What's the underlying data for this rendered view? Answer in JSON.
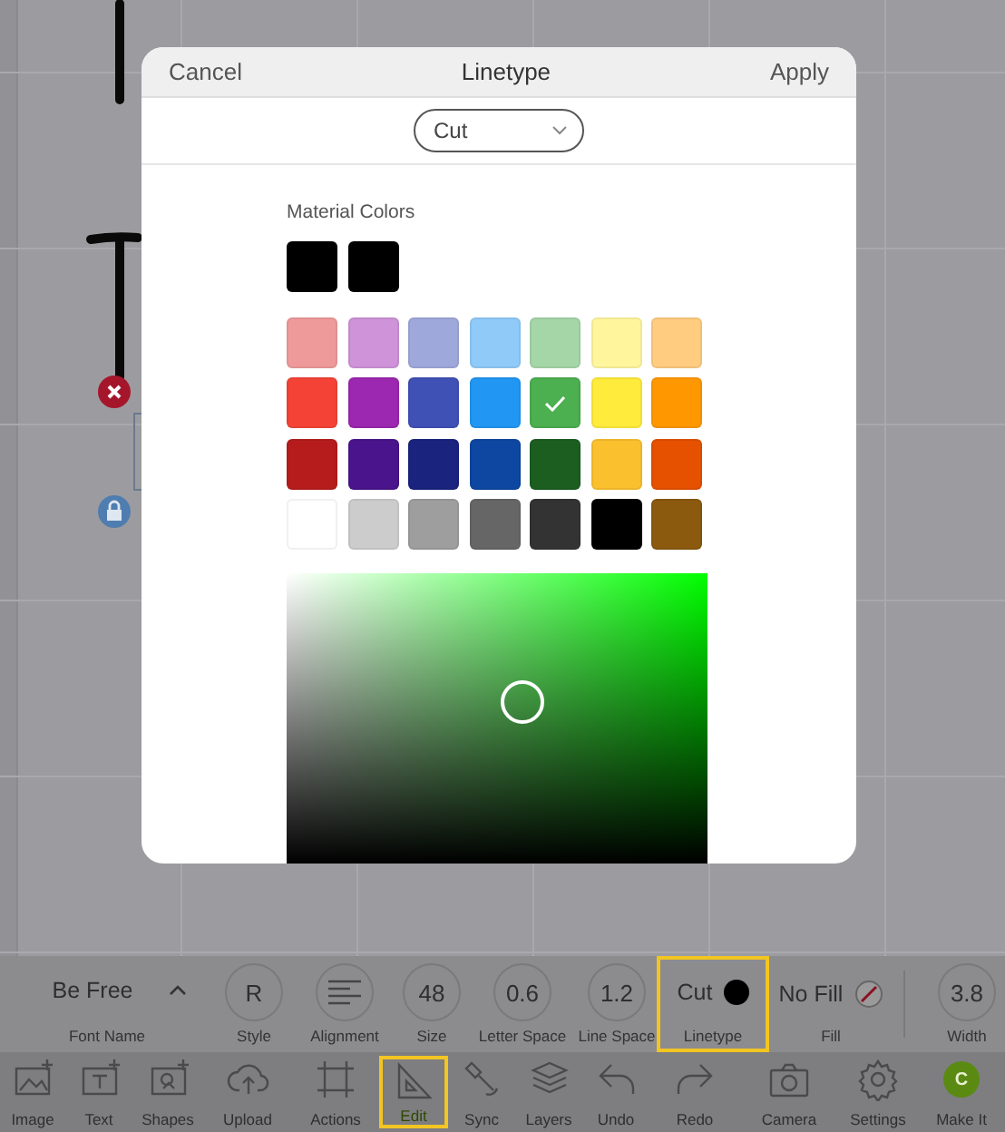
{
  "dialog": {
    "cancel": "Cancel",
    "title": "Linetype",
    "apply": "Apply",
    "linetype_dropdown": {
      "value": "Cut"
    },
    "section_label": "Material Colors",
    "basic_colors": [
      {
        "color": "#000000"
      },
      {
        "color": "#000000"
      }
    ],
    "palette": [
      {
        "color": "#ef9a9a",
        "selected": false
      },
      {
        "color": "#ce93d8",
        "selected": false
      },
      {
        "color": "#9fa8da",
        "selected": false
      },
      {
        "color": "#90caf9",
        "selected": false
      },
      {
        "color": "#a5d6a7",
        "selected": false
      },
      {
        "color": "#fff59d",
        "selected": false
      },
      {
        "color": "#ffcc80",
        "selected": false
      },
      {
        "color": "#f44336",
        "selected": false
      },
      {
        "color": "#9c27b0",
        "selected": false
      },
      {
        "color": "#3f51b5",
        "selected": false
      },
      {
        "color": "#2196f3",
        "selected": false
      },
      {
        "color": "#4caf50",
        "selected": true
      },
      {
        "color": "#ffeb3b",
        "selected": false
      },
      {
        "color": "#ff9800",
        "selected": false
      },
      {
        "color": "#b71c1c",
        "selected": false
      },
      {
        "color": "#4a148c",
        "selected": false
      },
      {
        "color": "#1a237e",
        "selected": false
      },
      {
        "color": "#0d47a1",
        "selected": false
      },
      {
        "color": "#1b5e20",
        "selected": false
      },
      {
        "color": "#fbc02d",
        "selected": false
      },
      {
        "color": "#e65100",
        "selected": false
      },
      {
        "color": "#ffffff",
        "selected": false
      },
      {
        "color": "#cccccc",
        "selected": false
      },
      {
        "color": "#9e9e9e",
        "selected": false
      },
      {
        "color": "#666666",
        "selected": false
      },
      {
        "color": "#333333",
        "selected": false
      },
      {
        "color": "#000000",
        "selected": false
      },
      {
        "color": "#8b5a0e",
        "selected": false
      }
    ]
  },
  "properties": [
    {
      "kind": "dropdown",
      "label": "Font Name",
      "value": "Be Free",
      "highlighted": false
    },
    {
      "kind": "circle",
      "label": "Style",
      "value": "R",
      "highlighted": false
    },
    {
      "kind": "align",
      "label": "Alignment",
      "highlighted": false
    },
    {
      "kind": "circle",
      "label": "Size",
      "value": "48",
      "highlighted": false
    },
    {
      "kind": "circle",
      "label": "Letter Space",
      "value": "0.6",
      "highlighted": false
    },
    {
      "kind": "circle",
      "label": "Line Space",
      "value": "1.2",
      "highlighted": false
    },
    {
      "kind": "swatch",
      "label": "Linetype",
      "value": "Cut",
      "color": "#000000",
      "highlighted": true
    },
    {
      "kind": "nofill",
      "label": "Fill",
      "value": "No Fill",
      "highlighted": false
    },
    {
      "kind": "circle",
      "label": "Width",
      "value": "3.8",
      "highlighted": false
    }
  ],
  "toolbar": [
    {
      "label": "Image",
      "highlighted": false
    },
    {
      "label": "Text",
      "highlighted": false
    },
    {
      "label": "Shapes",
      "highlighted": false
    },
    {
      "label": "Upload",
      "highlighted": false
    },
    {
      "label": "Actions",
      "highlighted": false
    },
    {
      "label": "Edit",
      "highlighted": true
    },
    {
      "label": "Sync",
      "highlighted": false
    },
    {
      "label": "Layers",
      "highlighted": false
    },
    {
      "label": "Undo",
      "highlighted": false
    },
    {
      "label": "Redo",
      "highlighted": false
    },
    {
      "label": "Camera",
      "highlighted": false
    },
    {
      "label": "Settings",
      "highlighted": false
    },
    {
      "label": "Make It",
      "badge": "C",
      "highlighted": false
    }
  ]
}
